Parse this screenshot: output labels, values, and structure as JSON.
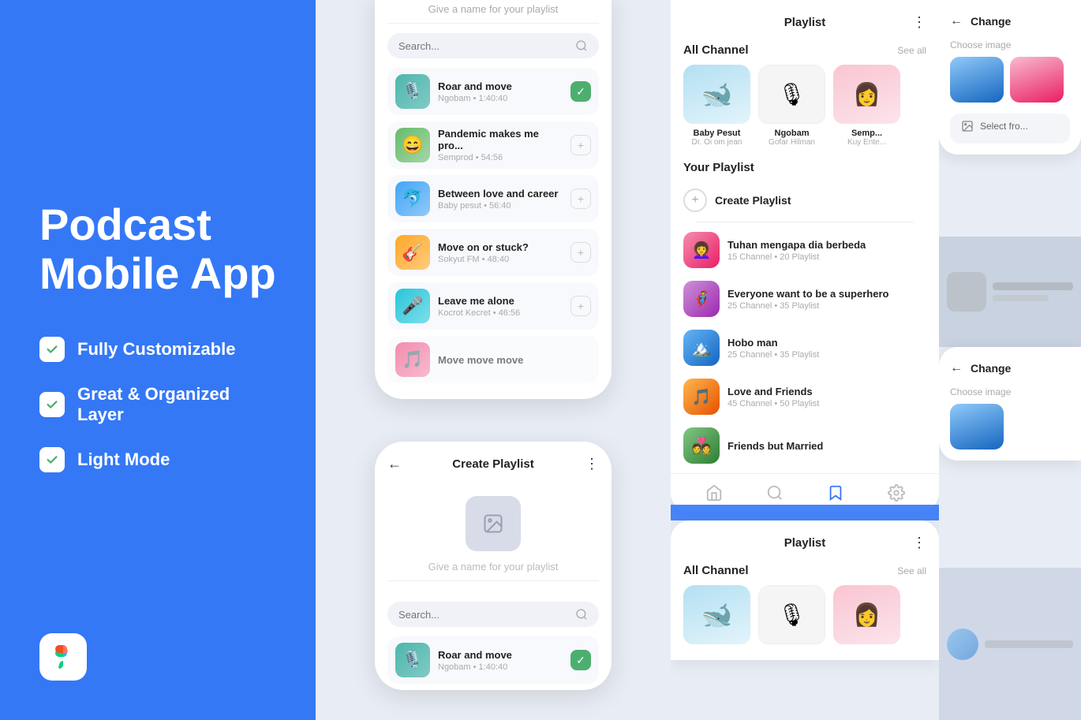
{
  "left": {
    "title_line1": "Podcast",
    "title_line2": "Mobile App",
    "features": [
      {
        "label": "Fully Customizable"
      },
      {
        "label": "Great & Organized Layer"
      },
      {
        "label": "Light Mode"
      }
    ]
  },
  "center_top": {
    "playlist_input_placeholder": "Give a name for your playlist",
    "search_placeholder": "Search...",
    "podcasts": [
      {
        "title": "Roar and move",
        "meta": "Ngobam • 1:40:40",
        "checked": true,
        "color": "teal"
      },
      {
        "title": "Pandemic makes me pro...",
        "meta": "Semprod • 54:56",
        "checked": false,
        "color": "green"
      },
      {
        "title": "Between love and career",
        "meta": "Baby pesut • 56:40",
        "checked": false,
        "color": "blue"
      },
      {
        "title": "Move on or stuck?",
        "meta": "Sokyut FM • 48:40",
        "checked": false,
        "color": "yellow"
      },
      {
        "title": "Leave me alone",
        "meta": "Kocrot Kecret • 46:56",
        "checked": false,
        "color": "cyan"
      },
      {
        "title": "Move move move",
        "meta": "",
        "checked": false,
        "color": "pink"
      }
    ]
  },
  "create_playlist": {
    "title": "Create Playlist",
    "name_placeholder": "Give a name for your playlist",
    "search_placeholder": "Search...",
    "podcasts": [
      {
        "title": "Roar and move",
        "meta": "Ngobam • 1:40:40",
        "checked": true,
        "color": "teal"
      }
    ]
  },
  "playlist_panel": {
    "title": "Playlist",
    "all_channel": "All Channel",
    "see_all": "See all",
    "channels": [
      {
        "name": "Baby Pesut",
        "author": "Dr. Oi om jean",
        "color": "blue"
      },
      {
        "name": "Ngobam",
        "author": "Gofar Hilman",
        "color": "white"
      },
      {
        "name": "Semp...",
        "author": "Kuy Ente...",
        "color": "pink"
      }
    ],
    "your_playlist": "Your Playlist",
    "create_playlist": "Create Playlist",
    "playlists": [
      {
        "name": "Tuhan mengapa dia berbeda",
        "meta": "15 Channel • 20 Playlist",
        "color": "pl1"
      },
      {
        "name": "Everyone want to be a superhero",
        "meta": "25 Channel • 35 Playlist",
        "color": "pl2"
      },
      {
        "name": "Hobo man",
        "meta": "25 Channel • 35 Playlist",
        "color": "pl3"
      },
      {
        "name": "Love and Friends",
        "meta": "45 Channel • 50 Playlist",
        "color": "pl4"
      },
      {
        "name": "Friends but Married",
        "meta": "",
        "color": "pl5"
      }
    ],
    "bottom_nav": [
      "home",
      "search",
      "bookmark",
      "settings"
    ]
  },
  "change_image": {
    "back_label": "←",
    "title": "Change",
    "choose_image": "Choose image",
    "select_from": "Select fro..."
  },
  "playlist_panel2": {
    "title": "Playlist",
    "all_channel": "All Channel",
    "see_all": "See all"
  }
}
